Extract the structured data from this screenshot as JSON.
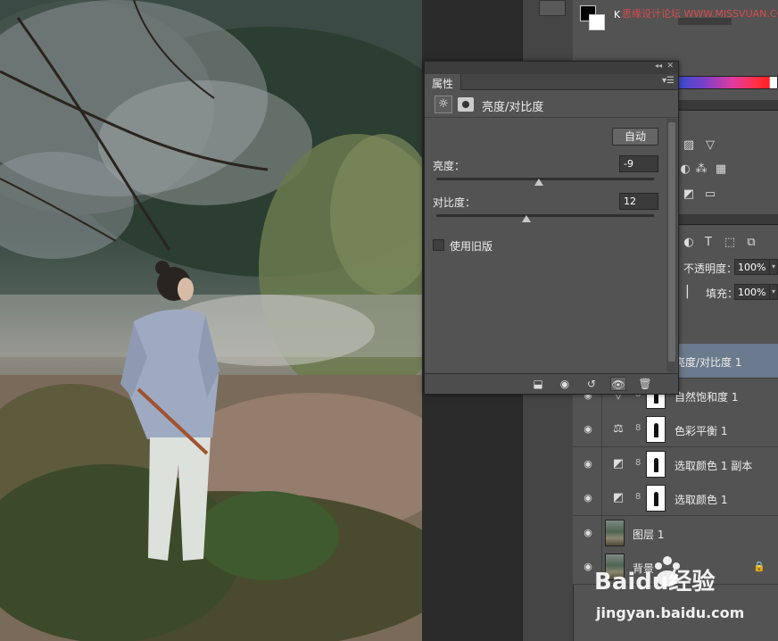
{
  "properties_panel": {
    "tab_label": "属性",
    "adjustment_title": "亮度/对比度",
    "auto_button": "自动",
    "brightness_label": "亮度：",
    "brightness_value": "-9",
    "brightness_slider": -9,
    "contrast_label": "对比度：",
    "contrast_value": "12",
    "contrast_slider": 12,
    "legacy_label": "使用旧版",
    "legacy_checked": false
  },
  "layers_panel": {
    "opacity_label": "不透明度：",
    "opacity_value": "100%",
    "fill_label": "填充：",
    "fill_value": "100%",
    "layers": [
      {
        "name": "亮度/对比度 1",
        "icon": "brightness-icon",
        "selected": true
      },
      {
        "name": "自然饱和度 1",
        "icon": "vibrance-icon",
        "selected": false
      },
      {
        "name": "色彩平衡 1",
        "icon": "balance-scale-icon",
        "selected": false
      },
      {
        "name": "选取颜色 1 副本",
        "icon": "selective-color-icon",
        "selected": false
      },
      {
        "name": "选取颜色 1",
        "icon": "selective-color-icon",
        "selected": false
      },
      {
        "name": "图层 1",
        "icon": "image-thumb",
        "selected": false
      },
      {
        "name": "背景",
        "icon": "image-thumb",
        "selected": false,
        "locked": true
      }
    ]
  },
  "color_panel": {
    "k_label": "K"
  },
  "watermarks": {
    "site": "思缘设计论坛 WWW.MISSVUAN.COM",
    "baidu_logo": "Baidu经验",
    "baidu_url": "jingyan.baidu.com"
  },
  "colors": {
    "panel_bg": "#535353",
    "selected_layer": "#6b7a8c",
    "dark_field": "#3b3b3b"
  }
}
